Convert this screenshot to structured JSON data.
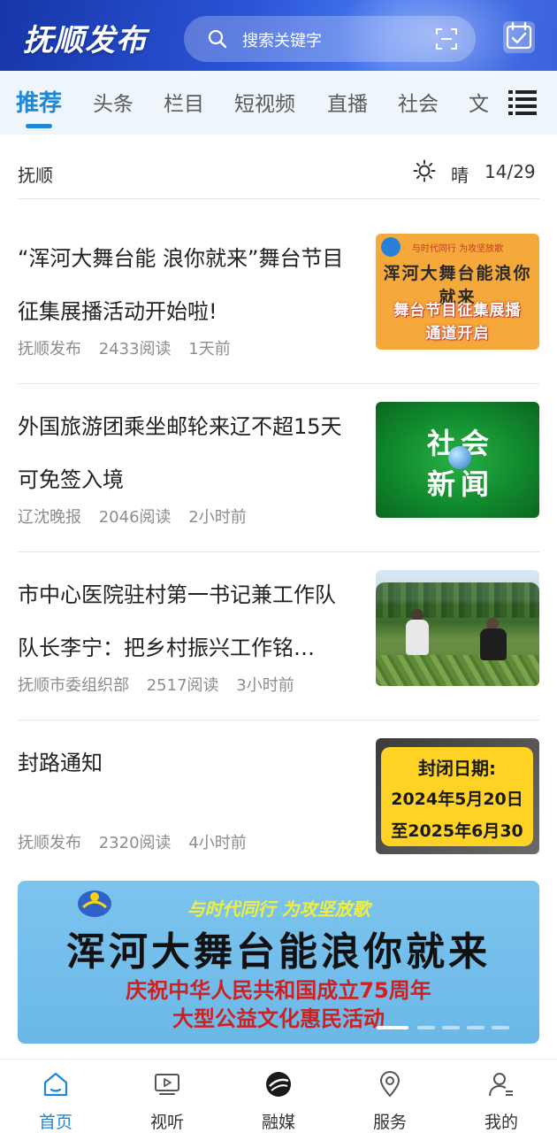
{
  "header": {
    "brand": "抚顺发布",
    "search_placeholder": "搜索关键字",
    "icons": [
      "search-icon",
      "scan-icon",
      "calendar-check-icon"
    ]
  },
  "tabs": [
    {
      "label": "推荐",
      "active": true
    },
    {
      "label": "头条",
      "active": false
    },
    {
      "label": "栏目",
      "active": false
    },
    {
      "label": "短视频",
      "active": false
    },
    {
      "label": "直播",
      "active": false
    },
    {
      "label": "社会",
      "active": false
    },
    {
      "label": "文",
      "active": false
    }
  ],
  "location_bar": {
    "city": "抚顺",
    "weather_icon": "sun-icon",
    "weather": "晴",
    "temperature": "14/29"
  },
  "news": [
    {
      "title": "“浑河大舞台能 浪你就来”舞台节目征集展播活动开始啦!",
      "source": "抚顺发布",
      "reads": "2433阅读",
      "time": "1天前",
      "thumb": {
        "line1": "与时代同行 为攻坚放歌",
        "line2": "浑河大舞台能浪你就来",
        "line3": "舞台节目征集展播",
        "line4": "通道开启"
      }
    },
    {
      "title": "外国旅游团乘坐邮轮来辽不超15天可免签入境",
      "source": "辽沈晚报",
      "reads": "2046阅读",
      "time": "2小时前",
      "thumb": {
        "line1": "社会",
        "line2": "新闻"
      }
    },
    {
      "title": "市中心医院驻村第一书记兼工作队队长李宁：把乡村振兴工作铭…",
      "source": "抚顺市委组织部",
      "reads": "2517阅读",
      "time": "3小时前",
      "thumb": {}
    },
    {
      "title": "封路通知",
      "source": "抚顺发布",
      "reads": "2320阅读",
      "time": "4小时前",
      "thumb": {
        "line1": "封闭日期:",
        "line2": "2024年5月20日",
        "line3": "至2025年6月30"
      }
    }
  ],
  "banner": {
    "line1": "与时代同行 为攻坚放歌",
    "line2": "浑河大舞台能浪你就来",
    "line3": "庆祝中华人民共和国成立75周年",
    "line4": "大型公益文化惠民活动",
    "pages": 5,
    "active_page": 1
  },
  "bottom_nav": [
    {
      "label": "首页",
      "icon": "home-icon",
      "active": true
    },
    {
      "label": "视听",
      "icon": "tv-icon",
      "active": false
    },
    {
      "label": "融媒",
      "icon": "media-logo-icon",
      "active": false
    },
    {
      "label": "服务",
      "icon": "location-pin-icon",
      "active": false
    },
    {
      "label": "我的",
      "icon": "user-icon",
      "active": false
    }
  ],
  "colors": {
    "accent": "#1e88d8",
    "header_bg": "#2a55d8",
    "tab_bar_bg": "#eef6fc"
  }
}
